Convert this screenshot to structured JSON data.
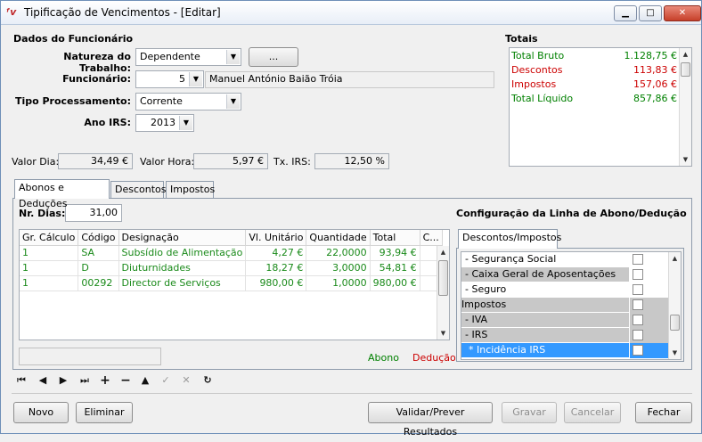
{
  "window": {
    "title": "Tipificação de Vencimentos - [Editar]",
    "app_icon": "fv-logo-icon",
    "controls": [
      "minimize-icon",
      "maximize-icon",
      "close-icon"
    ]
  },
  "employee": {
    "section_title": "Dados do Funcionário",
    "natureza_label": "Natureza do Trabalho:",
    "natureza_value": "Dependente",
    "ellipsis_label": "...",
    "funcionario_label": "Funcionário:",
    "funcionario_value": "5",
    "funcionario_name": "Manuel António Baião Tróia",
    "tipo_label": "Tipo Processamento:",
    "tipo_value": "Corrente",
    "ano_label": "Ano IRS:",
    "ano_value": "2013"
  },
  "rates": {
    "valor_dia_label": "Valor Dia:",
    "valor_dia": "34,49 €",
    "valor_hora_label": "Valor Hora:",
    "valor_hora": "5,97 €",
    "tx_irs_label": "Tx. IRS:",
    "tx_irs": "12,50 %"
  },
  "totals": {
    "title": "Totais",
    "rows": [
      {
        "label": "Total Bruto",
        "value": "1.128,75 €",
        "color": "#008000"
      },
      {
        "label": "Descontos",
        "value": "113,83 €",
        "color": "#cc0000"
      },
      {
        "label": "Impostos",
        "value": "157,06 €",
        "color": "#cc0000"
      },
      {
        "label": "Total Líquido",
        "value": "857,86 €",
        "color": "#008000"
      }
    ]
  },
  "tabs": {
    "items": [
      "Abonos e Deduções",
      "Descontos",
      "Impostos"
    ],
    "active": "Abonos e Deduções"
  },
  "abonos": {
    "nr_dias_label": "Nr. Dias:",
    "nr_dias": "31,00",
    "columns": [
      "Gr. Cálculo",
      "Código",
      "Designação",
      "Vl. Unitário",
      "Quantidade",
      "Total",
      "C..."
    ],
    "rows": [
      [
        "1",
        "SA",
        "Subsídio de Alimentação",
        "4,27 €",
        "22,0000",
        "93,94 €",
        ""
      ],
      [
        "1",
        "D",
        "Diuturnidades",
        "18,27 €",
        "3,0000",
        "54,81 €",
        ""
      ],
      [
        "1",
        "00292",
        "Director de Serviços",
        "980,00 €",
        "1,0000",
        "980,00 €",
        ""
      ]
    ],
    "legend_abono": "Abono",
    "legend_deducao": "Dedução",
    "legend_abono_color": "#008000",
    "legend_deducao_color": "#cc0000"
  },
  "config": {
    "title": "Configuração da Linha de Abono/Dedução",
    "tab": "Descontos/Impostos",
    "rows": [
      {
        "label": "- Segurança Social",
        "style": "normal"
      },
      {
        "label": "- Caixa Geral de Aposentações",
        "style": "shaded"
      },
      {
        "label": "- Seguro",
        "style": "normal"
      },
      {
        "label": "Impostos",
        "style": "shaded"
      },
      {
        "label": "- IVA",
        "style": "shaded"
      },
      {
        "label": "- IRS",
        "style": "shaded"
      },
      {
        "label": "* Incidência IRS",
        "style": "selected"
      }
    ]
  },
  "navigator": {
    "icons": [
      "first-record-icon",
      "prev-record-icon",
      "next-record-icon",
      "last-record-icon",
      "insert-icon",
      "delete-icon",
      "edit-icon",
      "post-icon",
      "cancel-icon",
      "refresh-icon"
    ]
  },
  "buttons": {
    "novo": "Novo",
    "eliminar": "Eliminar",
    "validar": "Validar/Prever Resultados",
    "gravar": "Gravar",
    "cancelar": "Cancelar",
    "fechar": "Fechar"
  }
}
